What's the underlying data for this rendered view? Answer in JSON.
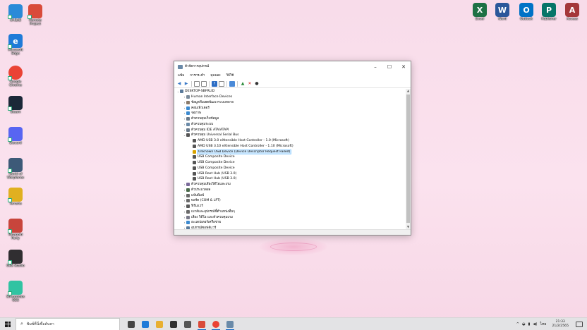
{
  "desktop_left": [
    {
      "label": "เครื่องนี้",
      "icon": "this-pc-icon",
      "color": "#2a8ad8"
    },
    {
      "label": "Remote Project",
      "icon": "remote-project-icon",
      "color": "#d94b3a"
    },
    {
      "label": "Microsoft Edge",
      "icon": "edge-icon",
      "color": "#1f7bd8",
      "glyph": "e"
    },
    {
      "label": "Google Chrome",
      "icon": "chrome-icon",
      "color": "#ea4335"
    },
    {
      "label": "Steam",
      "icon": "steam-icon",
      "color": "#1b2838"
    },
    {
      "label": "Discord",
      "icon": "discord-icon",
      "color": "#5865f2"
    },
    {
      "label": "World of Warplanes",
      "icon": "warplanes-icon",
      "color": "#3d5a78"
    },
    {
      "label": "Terraria",
      "icon": "terraria-icon",
      "color": "#e0b020"
    },
    {
      "label": "Paranoid Party",
      "icon": "paranoid-party-icon",
      "color": "#c8453c"
    },
    {
      "label": "OBS Studio",
      "icon": "obs-icon",
      "color": "#302e31"
    },
    {
      "label": "Streamlabs OBS",
      "icon": "streamlabs-icon",
      "color": "#31c3a2"
    }
  ],
  "desktop_right": [
    {
      "label": "Excel",
      "icon": "excel-icon",
      "color": "#1e7145",
      "glyph": "X"
    },
    {
      "label": "Word",
      "icon": "word-icon",
      "color": "#2b579a",
      "glyph": "W"
    },
    {
      "label": "Outlook",
      "icon": "outlook-icon",
      "color": "#0072c6",
      "glyph": "O"
    },
    {
      "label": "Publisher",
      "icon": "publisher-icon",
      "color": "#077568",
      "glyph": "P"
    },
    {
      "label": "Access",
      "icon": "access-icon",
      "color": "#a4373a",
      "glyph": "A"
    }
  ],
  "window": {
    "title": "ตัวจัดการอุปกรณ์",
    "menu": [
      "แฟ้ม",
      "การกระทำ",
      "มุมมอง",
      "วิธีใช้"
    ],
    "min": "–",
    "max": "☐",
    "close": "✕"
  },
  "tree": [
    {
      "text": "DESKTOP-SBFRLID",
      "level": 0,
      "exp": "⌄",
      "icon": "#5a7a9a"
    },
    {
      "text": "Human Interface Devices",
      "level": 1,
      "exp": "›",
      "icon": "#7a8a9a"
    },
    {
      "text": "ข้อมูลทีมเฮดพัฒนาระบบหลาย",
      "level": 1,
      "exp": "›",
      "icon": "#8a7a6a"
    },
    {
      "text": "คอมเพิวเตอร์",
      "level": 1,
      "exp": "›",
      "icon": "#3c8ad0"
    },
    {
      "text": "จอภาพ",
      "level": 1,
      "exp": "›",
      "icon": "#3c8ad0"
    },
    {
      "text": "ตัวควบคุมเก็บข้อมูล",
      "level": 1,
      "exp": "›",
      "icon": "#6a7a8a"
    },
    {
      "text": "ตัวควบคุมระบบ",
      "level": 1,
      "exp": "›",
      "icon": "#6a8aa8"
    },
    {
      "text": "ตัวควบคุม IDE ATA/ATAPI",
      "level": 1,
      "exp": "›",
      "icon": "#6a7a8a"
    },
    {
      "text": "ตัวควบคุม Universal Serial Bus",
      "level": 1,
      "exp": "⌄",
      "icon": "#555555"
    },
    {
      "text": "AMD USB 3.0 eXtensible Host Controller - 1.0 (Microsoft)",
      "level": 2,
      "exp": "",
      "icon": "#555555"
    },
    {
      "text": "AMD USB 3.10 eXtensible Host Controller - 1.10 (Microsoft)",
      "level": 2,
      "exp": "",
      "icon": "#555555"
    },
    {
      "text": "Unknown USB Device (Device Descriptor Request Failed)",
      "level": 2,
      "exp": "",
      "icon": "#d9a400",
      "selected": true
    },
    {
      "text": "USB Composite Device",
      "level": 2,
      "exp": "",
      "icon": "#555555"
    },
    {
      "text": "USB Composite Device",
      "level": 2,
      "exp": "",
      "icon": "#555555"
    },
    {
      "text": "USB Composite Device",
      "level": 2,
      "exp": "",
      "icon": "#555555"
    },
    {
      "text": "USB Root Hub (USB 3.0)",
      "level": 2,
      "exp": "",
      "icon": "#555555"
    },
    {
      "text": "USB Root Hub (USB 3.0)",
      "level": 2,
      "exp": "",
      "icon": "#555555"
    },
    {
      "text": "ตัวควบคุมเสียงวิดีโอและเกม",
      "level": 1,
      "exp": "›",
      "icon": "#7a6a9a"
    },
    {
      "text": "ตัวประมวลผล",
      "level": 1,
      "exp": "›",
      "icon": "#4a6a4a"
    },
    {
      "text": "แป้นพิมพ์",
      "level": 1,
      "exp": "›",
      "icon": "#6a6a6a"
    },
    {
      "text": "พอร์ต (COM & LPT)",
      "level": 1,
      "exp": "›",
      "icon": "#6a6a6a"
    },
    {
      "text": "ฟิร์มแวร์",
      "level": 1,
      "exp": "›",
      "icon": "#5a5a5a"
    },
    {
      "text": "เมาส์และอุปกรณ์ชี้ตำแหน่งอื่นๆ",
      "level": 1,
      "exp": "›",
      "icon": "#6a6a6a"
    },
    {
      "text": "เสียง วิดีโอ และตัวควบคุมเกม",
      "level": 1,
      "exp": "›",
      "icon": "#7a7a8a"
    },
    {
      "text": "อะแดปเตอร์เครือข่าย",
      "level": 1,
      "exp": "›",
      "icon": "#3c8ad0"
    },
    {
      "text": "อุปกรณ์ซอฟต์แวร์",
      "level": 1,
      "exp": "›",
      "icon": "#5a7a9a"
    }
  ],
  "taskbar": {
    "search_placeholder": "พิมพ์ที่นี่เพื่อค้นหา",
    "apps": [
      {
        "name": "task-view-icon",
        "color": "#444444"
      },
      {
        "name": "edge-taskbar-icon",
        "color": "#1f7bd8"
      },
      {
        "name": "file-explorer-icon",
        "color": "#e8b030"
      },
      {
        "name": "store-icon",
        "color": "#303030"
      },
      {
        "name": "mail-icon",
        "color": "#555555"
      },
      {
        "name": "remote-taskbar-icon",
        "color": "#d94b3a"
      },
      {
        "name": "chrome-taskbar-icon",
        "color": "#ea4335"
      },
      {
        "name": "device-manager-taskbar-icon",
        "color": "#6a8aa8"
      }
    ],
    "tray_lang": "ไทย",
    "time": "21:33",
    "date": "21/2/2565"
  }
}
